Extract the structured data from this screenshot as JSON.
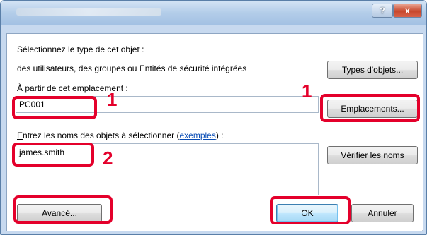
{
  "window": {
    "help_label": "?",
    "close_label": "x"
  },
  "object_type": {
    "prompt": "Sélectionnez le type de cet objet :",
    "value": "des utilisateurs, des groupes ou Entités de sécurité intégrées",
    "button": "Types d'objets..."
  },
  "location": {
    "prompt_prefix": "À",
    "prompt_ul": " ",
    "prompt_rest": "partir de cet emplacement :",
    "value": "PC001",
    "button": "Emplacements..."
  },
  "names": {
    "prompt_ul": "E",
    "prompt_rest": "ntrez les noms des objets à sélectionner (",
    "link": "exemples",
    "prompt_end": ") :",
    "value": "james.smith",
    "check_button": "Vérifier les noms"
  },
  "footer": {
    "advanced_button": "Avancé...",
    "ok_button": "OK",
    "cancel_button": "Annuler"
  },
  "annotations": {
    "step1_a": "1",
    "step1_b": "1",
    "step2": "2"
  },
  "accent_color": "#e4002b"
}
